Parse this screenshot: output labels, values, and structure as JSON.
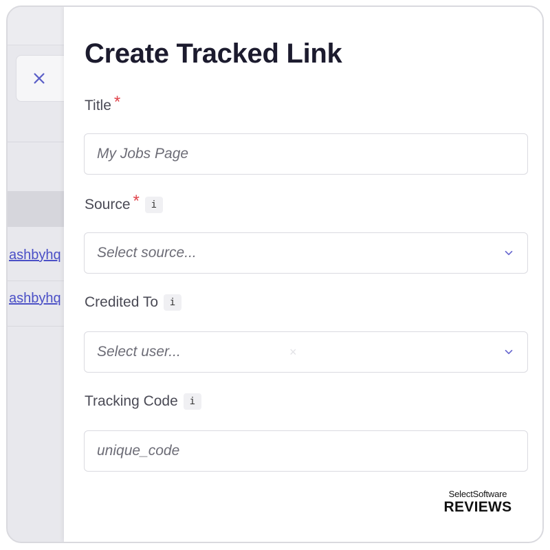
{
  "background": {
    "links": [
      "ashbyhq",
      "ashbyhq"
    ]
  },
  "drawer": {
    "title": "Create Tracked Link",
    "fields": {
      "title": {
        "label": "Title",
        "required": "*",
        "placeholder": "My Jobs Page"
      },
      "source": {
        "label": "Source",
        "required": "*",
        "info": "i",
        "placeholder": "Select source..."
      },
      "credited_to": {
        "label": "Credited To",
        "info": "i",
        "placeholder": "Select user...",
        "clear": "×"
      },
      "tracking_code": {
        "label": "Tracking Code",
        "info": "i",
        "placeholder": "unique_code"
      }
    }
  },
  "watermark": {
    "top": "SelectSoftware",
    "bottom": "REVIEWS"
  },
  "colors": {
    "accent": "#4a4fc6",
    "required": "#e0424a",
    "title": "#1c1b2e"
  },
  "icons": [
    "close-icon",
    "info-icon",
    "chevron-down-icon",
    "clear-icon"
  ]
}
